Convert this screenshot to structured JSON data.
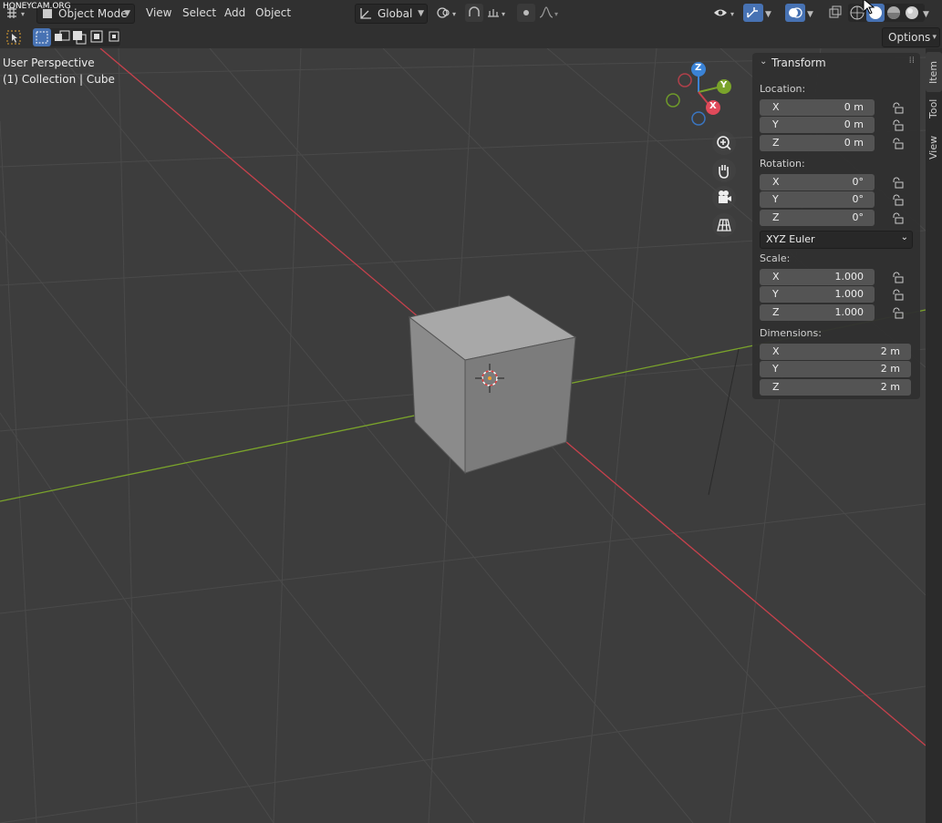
{
  "watermark": "HONEYCAM.ORG",
  "header": {
    "mode": "Object Mode",
    "menus": [
      "View",
      "Select",
      "Add",
      "Object"
    ],
    "orientation": "Global",
    "options": "Options"
  },
  "overlay": {
    "perspective": "User Perspective",
    "collection": "(1) Collection | Cube"
  },
  "gizmo": {
    "z": "Z",
    "y": "Y",
    "x": "X"
  },
  "tabs": [
    "Item",
    "Tool",
    "View"
  ],
  "panel": {
    "title": "Transform",
    "location_label": "Location:",
    "location": [
      {
        "axis": "X",
        "value": "0 m"
      },
      {
        "axis": "Y",
        "value": "0 m"
      },
      {
        "axis": "Z",
        "value": "0 m"
      }
    ],
    "rotation_label": "Rotation:",
    "rotation": [
      {
        "axis": "X",
        "value": "0°"
      },
      {
        "axis": "Y",
        "value": "0°"
      },
      {
        "axis": "Z",
        "value": "0°"
      }
    ],
    "rotation_mode": "XYZ Euler",
    "scale_label": "Scale:",
    "scale": [
      {
        "axis": "X",
        "value": "1.000"
      },
      {
        "axis": "Y",
        "value": "1.000"
      },
      {
        "axis": "Z",
        "value": "1.000"
      }
    ],
    "dimensions_label": "Dimensions:",
    "dimensions": [
      {
        "axis": "X",
        "value": "2 m"
      },
      {
        "axis": "Y",
        "value": "2 m"
      },
      {
        "axis": "Z",
        "value": "2 m"
      }
    ]
  },
  "colors": {
    "x_axis": "#c6414c",
    "y_axis": "#7aa32b",
    "z_axis": "#3b83d6",
    "accent": "#4772b3"
  },
  "icons": [
    "editor-type-icon",
    "object-mode-icon",
    "transform-orientation-icon",
    "pivot-icon",
    "snap-icon",
    "proportional-icon",
    "visibility-icon",
    "gizmo-icon",
    "overlay-icon",
    "xray-icon",
    "wireframe-shading-icon",
    "solid-shading-icon",
    "material-shading-icon",
    "rendered-shading-icon",
    "select-tool-icon",
    "zoom-icon",
    "pan-hand-icon",
    "camera-icon",
    "grid-perspective-icon",
    "lock-icon"
  ]
}
